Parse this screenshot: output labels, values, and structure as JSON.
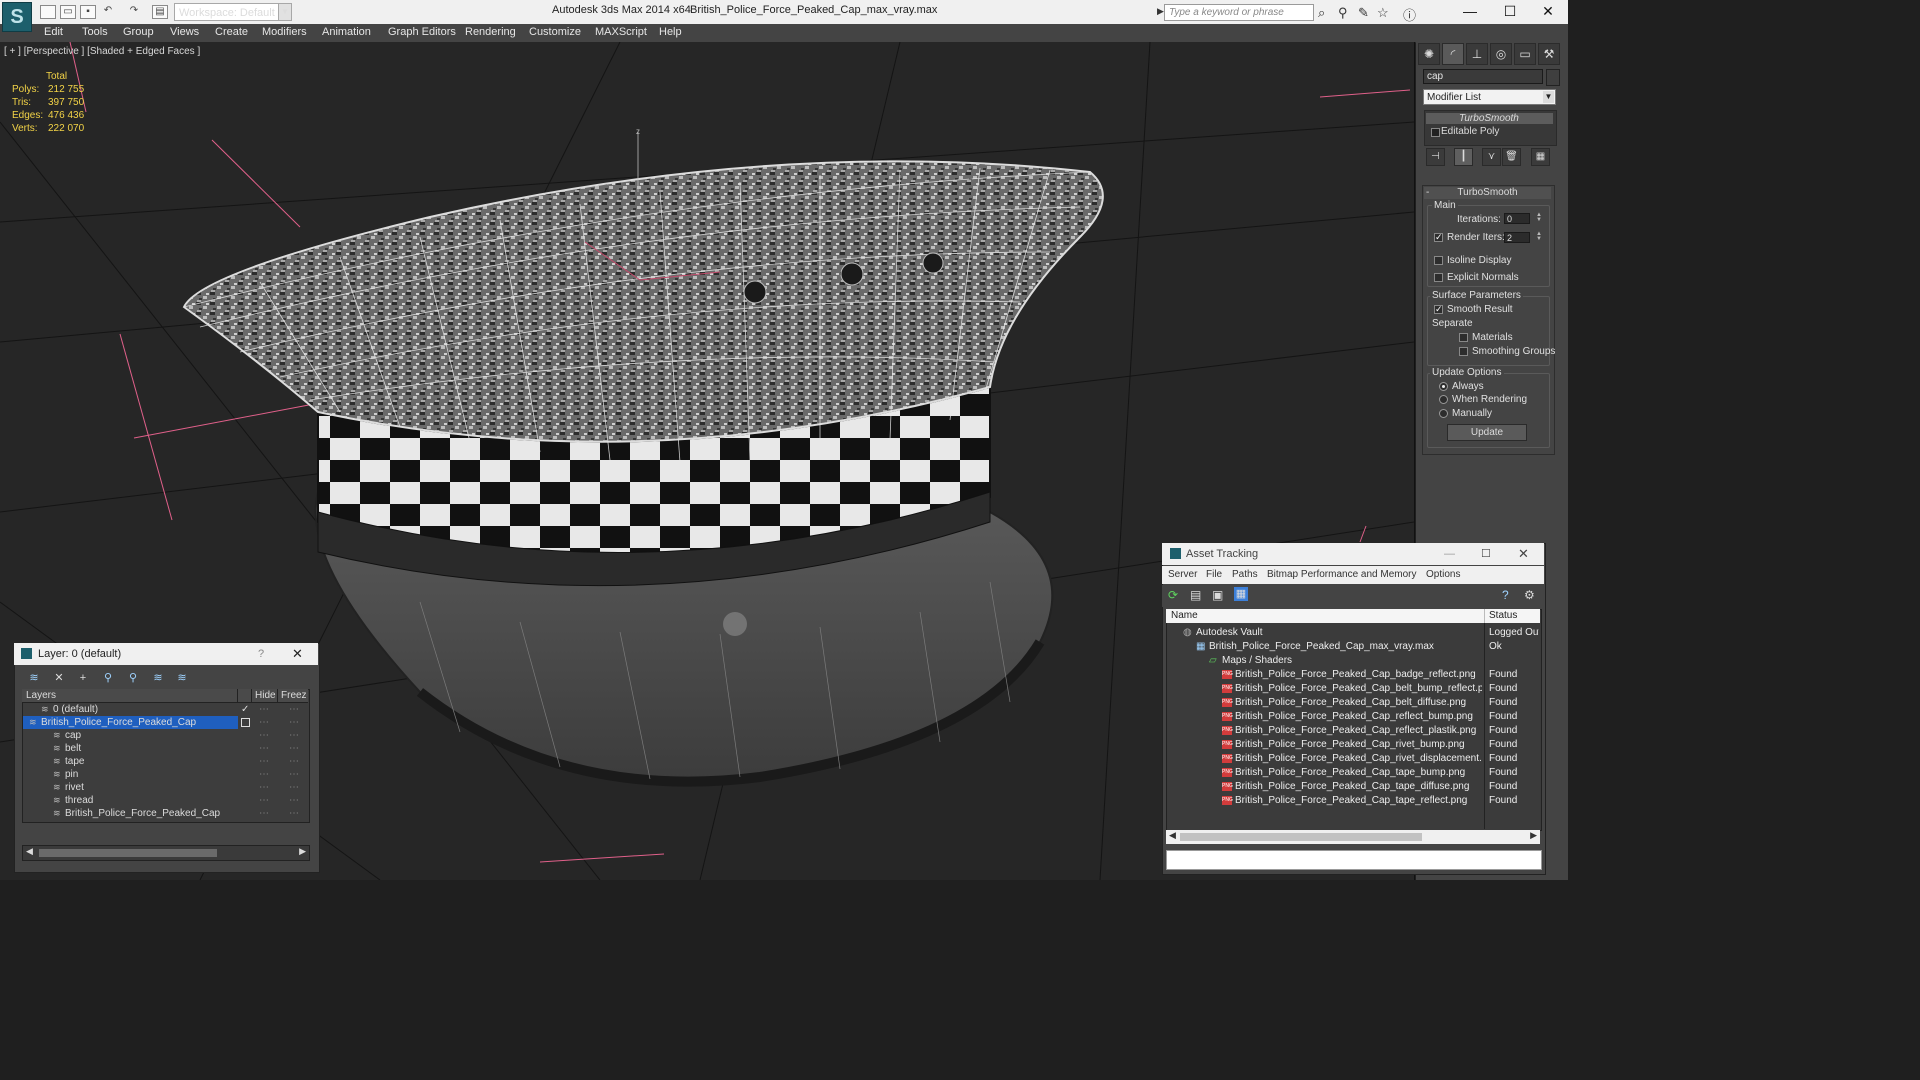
{
  "titlebar": {
    "workspace_label": "Workspace: Default",
    "app_title": "Autodesk 3ds Max  2014 x64",
    "doc_title": "British_Police_Force_Peaked_Cap_max_vray.max",
    "search_placeholder": "Type a keyword or phrase"
  },
  "menu": [
    "Edit",
    "Tools",
    "Group",
    "Views",
    "Create",
    "Modifiers",
    "Animation",
    "Graph Editors",
    "Rendering",
    "Customize",
    "MAXScript",
    "Help"
  ],
  "viewport": {
    "label": "[ + ] [Perspective ] [Shaded + Edged Faces ]",
    "stats": {
      "total_label": "Total",
      "polys_label": "Polys:",
      "polys": "212 755",
      "tris_label": "Tris:",
      "tris": "397 750",
      "edges_label": "Edges:",
      "edges": "476 436",
      "verts_label": "Verts:",
      "verts": "222 070"
    }
  },
  "command_panel": {
    "object_name": "cap",
    "modifier_list": "Modifier List",
    "stack": [
      "TurboSmooth",
      "Editable Poly"
    ],
    "turbosmooth": {
      "header": "TurboSmooth",
      "main_label": "Main",
      "iterations_label": "Iterations:",
      "iterations": "0",
      "render_iters_label": "Render Iters:",
      "render_iters": "2",
      "isoline_label": "Isoline Display",
      "explicit_normals_label": "Explicit Normals",
      "surface_params_label": "Surface Parameters",
      "smooth_result_label": "Smooth Result",
      "separate_label": "Separate",
      "materials_label": "Materials",
      "smoothing_groups_label": "Smoothing Groups",
      "update_options_label": "Update Options",
      "always_label": "Always",
      "when_rendering_label": "When Rendering",
      "manually_label": "Manually",
      "update_button": "Update"
    }
  },
  "layer_window": {
    "title": "Layer: 0 (default)",
    "help": "?",
    "col_layers": "Layers",
    "col_hide": "Hide",
    "col_freeze": "Freeze",
    "rows": [
      {
        "name": "0 (default)",
        "indent": 1
      },
      {
        "name": "British_Police_Force_Peaked_Cap",
        "indent": 0
      },
      {
        "name": "cap",
        "indent": 2
      },
      {
        "name": "belt",
        "indent": 2
      },
      {
        "name": "tape",
        "indent": 2
      },
      {
        "name": "pin",
        "indent": 2
      },
      {
        "name": "rivet",
        "indent": 2
      },
      {
        "name": "thread",
        "indent": 2
      },
      {
        "name": "British_Police_Force_Peaked_Cap",
        "indent": 2
      }
    ]
  },
  "asset_window": {
    "title": "Asset Tracking",
    "menu": [
      "Server",
      "File",
      "Paths",
      "Bitmap Performance and Memory",
      "Options"
    ],
    "col_name": "Name",
    "col_status": "Status",
    "rows": [
      {
        "name": "Autodesk Vault",
        "status": "Logged Out",
        "indent": 0,
        "icon": "vault"
      },
      {
        "name": "British_Police_Force_Peaked_Cap_max_vray.max",
        "status": "Ok",
        "indent": 1,
        "icon": "max"
      },
      {
        "name": "Maps / Shaders",
        "status": "",
        "indent": 2,
        "icon": "folder"
      },
      {
        "name": "British_Police_Force_Peaked_Cap_badge_reflect.png",
        "status": "Found",
        "indent": 3,
        "icon": "png"
      },
      {
        "name": "British_Police_Force_Peaked_Cap_belt_bump_reflect.png",
        "status": "Found",
        "indent": 3,
        "icon": "png"
      },
      {
        "name": "British_Police_Force_Peaked_Cap_belt_diffuse.png",
        "status": "Found",
        "indent": 3,
        "icon": "png"
      },
      {
        "name": "British_Police_Force_Peaked_Cap_reflect_bump.png",
        "status": "Found",
        "indent": 3,
        "icon": "png"
      },
      {
        "name": "British_Police_Force_Peaked_Cap_reflect_plastik.png",
        "status": "Found",
        "indent": 3,
        "icon": "png"
      },
      {
        "name": "British_Police_Force_Peaked_Cap_rivet_bump.png",
        "status": "Found",
        "indent": 3,
        "icon": "png"
      },
      {
        "name": "British_Police_Force_Peaked_Cap_rivet_displacement.png",
        "status": "Found",
        "indent": 3,
        "icon": "png"
      },
      {
        "name": "British_Police_Force_Peaked_Cap_tape_bump.png",
        "status": "Found",
        "indent": 3,
        "icon": "png"
      },
      {
        "name": "British_Police_Force_Peaked_Cap_tape_diffuse.png",
        "status": "Found",
        "indent": 3,
        "icon": "png"
      },
      {
        "name": "British_Police_Force_Peaked_Cap_tape_reflect.png",
        "status": "Found",
        "indent": 3,
        "icon": "png"
      }
    ]
  },
  "colors": {
    "stats_text": "#f2d347",
    "selection": "#1f5fbf",
    "viewport_bg": "#262626",
    "grid_lines": "#111111",
    "axis_lines": "#e0608a"
  }
}
